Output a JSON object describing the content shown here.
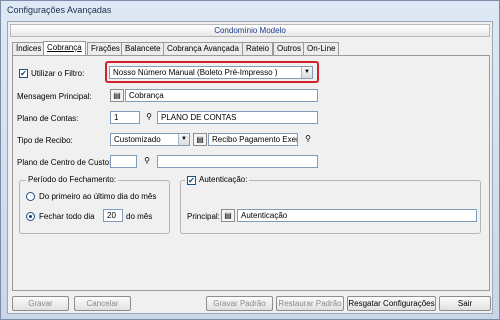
{
  "window": {
    "title": "Configurações Avançadas"
  },
  "header": {
    "title": "Condomínio Modelo"
  },
  "tabs": [
    {
      "label": "Índices"
    },
    {
      "label": "Cobrança"
    },
    {
      "label": "Frações"
    },
    {
      "label": "Balancete"
    },
    {
      "label": "Cobrança Avançada"
    },
    {
      "label": "Rateio"
    },
    {
      "label": "Outros"
    },
    {
      "label": "On-Line"
    }
  ],
  "active_tab": "Cobrança",
  "filter": {
    "label": "Utilizar o Filtro:",
    "checked": true,
    "value": "Nosso Número Manual (Boleto Pré-Impresso )"
  },
  "mensagem": {
    "label": "Mensagem Principal:",
    "value": "Cobrança"
  },
  "plano_contas": {
    "label": "Plano de Contas:",
    "code": "1",
    "name": "PLANO DE CONTAS"
  },
  "tipo_recibo": {
    "label": "Tipo de Recibo:",
    "value": "Customizado",
    "name": "Recibo Pagamento Exemplo"
  },
  "plano_centro": {
    "label": "Plano de Centro de Custo:",
    "code": "",
    "name": ""
  },
  "periodo": {
    "legend": "Período do Fechamento:",
    "option1": "Do primeiro ao último dia do mês",
    "option2_prefix": "Fechar todo dia",
    "option2_day": "20",
    "option2_suffix": "do mês",
    "selected": 2
  },
  "autenticacao": {
    "legend": "Autenticação:",
    "checked": true,
    "label": "Principal:",
    "value": "Autenticação"
  },
  "buttons": {
    "gravar": "Gravar",
    "cancelar": "Cancelar",
    "gravar_padrao": "Gravar Padrão",
    "restaurar_padrao": "Restaurar Padrão",
    "resgatar": "Resgatar Configurações",
    "sair": "Sair"
  },
  "colors": {
    "highlight": "#d0202e",
    "header_text": "#1b3a8a"
  }
}
